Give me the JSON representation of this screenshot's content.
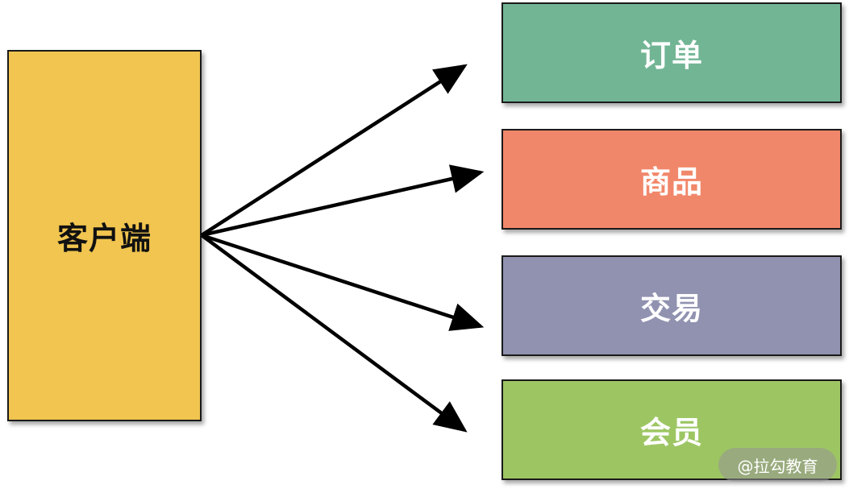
{
  "client": {
    "label": "客户端",
    "color": "#f1c54f"
  },
  "services": [
    {
      "label": "订单",
      "color": "#72b595"
    },
    {
      "label": "商品",
      "color": "#f1876a"
    },
    {
      "label": "交易",
      "color": "#9092b0"
    },
    {
      "label": "会员",
      "color": "#9dc663"
    }
  ],
  "edges": [
    {
      "from": "客户端",
      "to": "订单"
    },
    {
      "from": "客户端",
      "to": "商品"
    },
    {
      "from": "客户端",
      "to": "交易"
    },
    {
      "from": "客户端",
      "to": "会员"
    }
  ],
  "watermark": "@拉勾教育"
}
